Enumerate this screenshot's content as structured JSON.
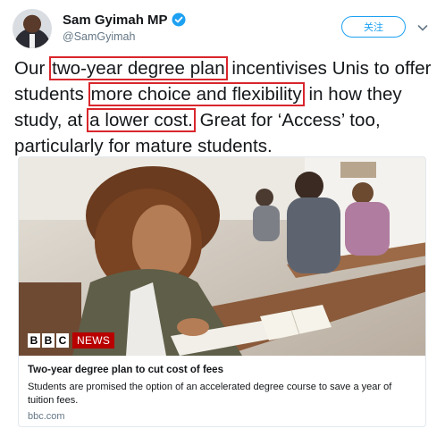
{
  "author": {
    "display_name": "Sam Gyimah MP",
    "handle": "@SamGyimah",
    "verified": true
  },
  "follow_button": {
    "label": "关注"
  },
  "tweet": {
    "segments": [
      {
        "text": "Our ",
        "highlight": false
      },
      {
        "text": "two-year degree plan",
        "highlight": true
      },
      {
        "text": " incentivises Unis to offer students ",
        "highlight": false
      },
      {
        "text": "more choice and flexibility",
        "highlight": true
      },
      {
        "text": " in how they study, at ",
        "highlight": false
      },
      {
        "text": "a lower cost.",
        "highlight": true
      },
      {
        "text": " Great for ‘Access’ too, particularly for mature students.",
        "highlight": false
      }
    ]
  },
  "card": {
    "logo_letters": [
      "B",
      "B",
      "C"
    ],
    "logo_word": "NEWS",
    "title": "Two-year degree plan to cut cost of fees",
    "description": "Students are promised the option of an accelerated degree course to save a year of tuition fees.",
    "domain": "bbc.com"
  },
  "colors": {
    "highlight_border": "#d9262c",
    "link_blue": "#1da1f2",
    "bbc_red": "#b80000"
  },
  "icons": [
    "verified-badge-icon",
    "chevron-down-icon"
  ]
}
